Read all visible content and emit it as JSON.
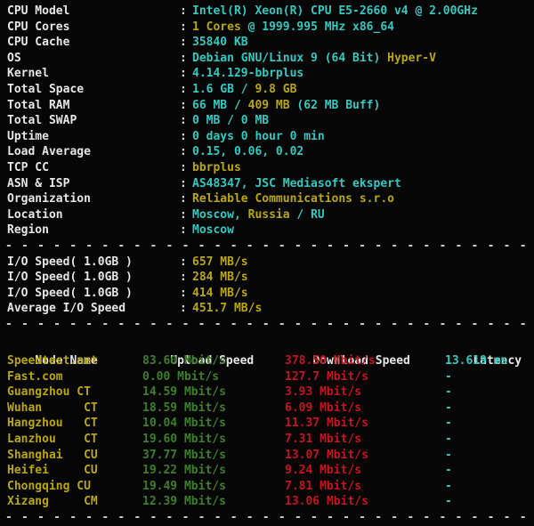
{
  "terminal": {
    "background": "#060606",
    "colors": {
      "label": "#e6e6e6",
      "cyan": "#36c8c0",
      "yellow": "#b8a613",
      "green": "#3f7d2e",
      "red": "#c01621",
      "separator": "#cfcfcf"
    },
    "separator_text": "- - - - - - - - - - - - - - - - - - - - - - - - - - - - - - - - - - - - - - - - - - - - - - - - - - - - - - - - - -"
  },
  "system_info": {
    "rows": [
      {
        "label": "CPU Model",
        "colon": ":",
        "value_a": "Intel(R) Xeon(R) CPU E5-2660 v4 @ 2.00GHz",
        "value_b": "",
        "value_c": ""
      },
      {
        "label": "CPU Cores",
        "colon": ":",
        "value_a": "",
        "value_b": "1 Cores",
        "value_c": " @ 1999.995 MHz x86_64"
      },
      {
        "label": "CPU Cache",
        "colon": ":",
        "value_a": "35840 KB",
        "value_b": "",
        "value_c": ""
      },
      {
        "label": "OS",
        "colon": ":",
        "value_a": "Debian GNU/Linux 9 (64 Bit) ",
        "value_b": "Hyper-V",
        "value_c": ""
      },
      {
        "label": "Kernel",
        "colon": ":",
        "value_a": "4.14.129-bbrplus",
        "value_b": "",
        "value_c": ""
      },
      {
        "label": "Total Space",
        "colon": ":",
        "value_a": "1.6 GB / ",
        "value_b": "9.8 GB",
        "value_c": ""
      },
      {
        "label": "Total RAM",
        "colon": ":",
        "value_a": "66 MB / ",
        "value_b": "409 MB",
        "value_c": " (62 MB Buff)"
      },
      {
        "label": "Total SWAP",
        "colon": ":",
        "value_a": "0 MB / 0 MB",
        "value_b": "",
        "value_c": ""
      },
      {
        "label": "Uptime",
        "colon": ":",
        "value_a": "0 days 0 hour 0 min",
        "value_b": "",
        "value_c": ""
      },
      {
        "label": "Load Average",
        "colon": ":",
        "value_a": "0.15, 0.06, 0.02",
        "value_b": "",
        "value_c": ""
      },
      {
        "label": "TCP CC",
        "colon": ":",
        "value_a": "",
        "value_b": "bbrplus",
        "value_c": ""
      },
      {
        "label": "ASN & ISP",
        "colon": ":",
        "value_a": "AS48347, JSC Mediasoft ekspert",
        "value_b": "",
        "value_c": ""
      },
      {
        "label": "Organization",
        "colon": ":",
        "value_a": "",
        "value_b": "Reliable Communications s.r.o",
        "value_c": ""
      },
      {
        "label": "Location",
        "colon": ":",
        "value_a": "Moscow, ",
        "value_b": "Russia",
        "value_c": " / RU"
      },
      {
        "label": "Region",
        "colon": ":",
        "value_a": "Moscow",
        "value_b": "",
        "value_c": ""
      }
    ]
  },
  "io_speed": {
    "rows": [
      {
        "label": "I/O Speed( 1.0GB )",
        "colon": ":",
        "value": "657 MB/s"
      },
      {
        "label": "I/O Speed( 1.0GB )",
        "colon": ":",
        "value": "284 MB/s"
      },
      {
        "label": "I/O Speed( 1.0GB )",
        "colon": ":",
        "value": "414 MB/s"
      },
      {
        "label": "Average I/O Speed",
        "colon": ":",
        "value": "451.7 MB/s"
      }
    ]
  },
  "speedtest": {
    "header": {
      "node_name": "Node Name",
      "upload": "Upload Speed",
      "download": "Download Speed",
      "latency": "Latency"
    },
    "rows": [
      {
        "node": "Speedtest.net",
        "upload": "83.60 Mbit/s",
        "download": "378.50 Mbit/s",
        "latency": "13.619 ms"
      },
      {
        "node": "Fast.com",
        "upload": "0.00 Mbit/s",
        "download": "127.7 Mbit/s",
        "latency": "-"
      },
      {
        "node": "Guangzhou CT",
        "upload": "14.59 Mbit/s",
        "download": "3.93 Mbit/s",
        "latency": "-"
      },
      {
        "node": "Wuhan      CT",
        "upload": "18.59 Mbit/s",
        "download": "6.09 Mbit/s",
        "latency": "-"
      },
      {
        "node": "Hangzhou   CT",
        "upload": "10.04 Mbit/s",
        "download": "11.37 Mbit/s",
        "latency": "-"
      },
      {
        "node": "Lanzhou    CT",
        "upload": "19.60 Mbit/s",
        "download": "7.31 Mbit/s",
        "latency": "-"
      },
      {
        "node": "Shanghai   CU",
        "upload": "37.77 Mbit/s",
        "download": "13.07 Mbit/s",
        "latency": "-"
      },
      {
        "node": "Heifei     CU",
        "upload": "19.22 Mbit/s",
        "download": "9.24 Mbit/s",
        "latency": "-"
      },
      {
        "node": "Chongqing CU",
        "upload": "19.49 Mbit/s",
        "download": "7.81 Mbit/s",
        "latency": "-"
      },
      {
        "node": "Xizang     CM",
        "upload": "12.39 Mbit/s",
        "download": "13.06 Mbit/s",
        "latency": "-"
      }
    ]
  }
}
